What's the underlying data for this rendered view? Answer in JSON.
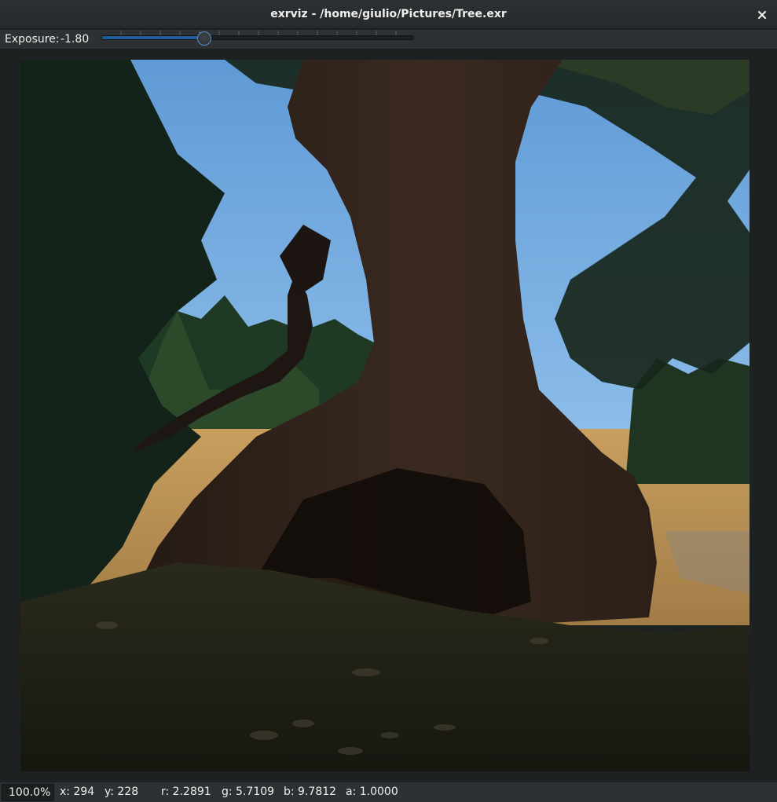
{
  "window": {
    "title": "exrviz - /home/giulio/Pictures/Tree.exr",
    "close_icon": "close-icon"
  },
  "toolbar": {
    "exposure_label": "Exposure:",
    "exposure_value": "-1.80",
    "exposure_slider_fraction": 0.33
  },
  "image": {
    "subject": "silhouetted tree trunk",
    "sky_color": "#74a8dc",
    "grass_color": "#b58d52",
    "foliage_color": "#17261b"
  },
  "status": {
    "zoom": "100.0%",
    "x": "x: 294",
    "y": "y: 228",
    "r": "r: 2.2891",
    "g": "g: 5.7109",
    "b": "b: 9.7812",
    "a": "a: 1.0000"
  },
  "colors": {
    "accent": "#215d9c",
    "background": "#1e2122",
    "panel": "#2d3133"
  }
}
